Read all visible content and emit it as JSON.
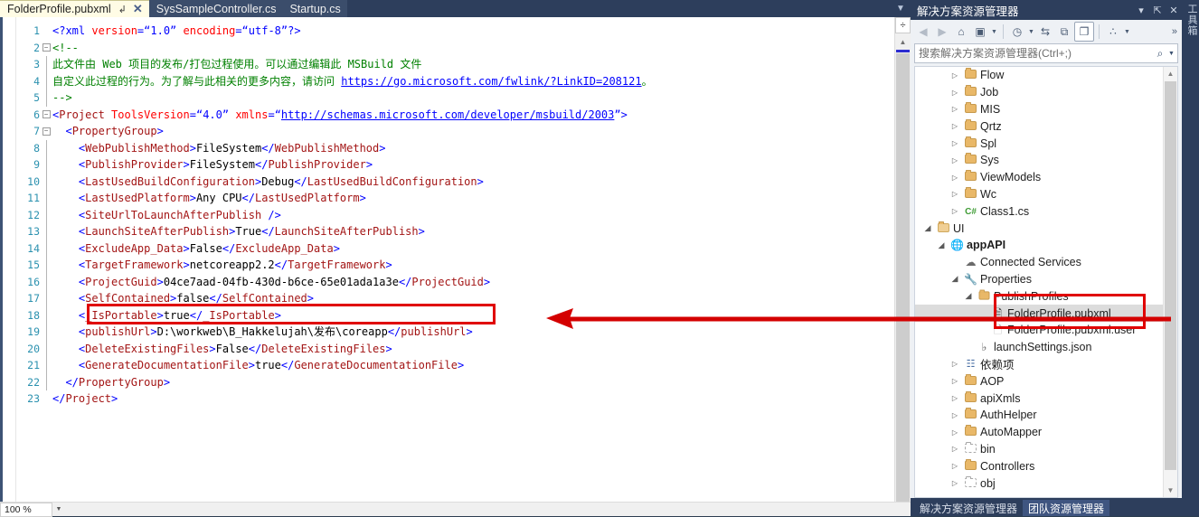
{
  "window": {
    "editor_tabs": [
      {
        "label": "FolderProfile.pubxml",
        "active": true,
        "pin": "↲",
        "close": "✕"
      },
      {
        "label": "SysSampleController.cs",
        "active": false
      },
      {
        "label": "Startup.cs",
        "active": false
      }
    ],
    "tab_overflow_icon": "chevron-down"
  },
  "editor": {
    "zoom_level": "100 %",
    "line_numbers": [
      1,
      2,
      3,
      4,
      5,
      6,
      7,
      8,
      9,
      10,
      11,
      12,
      13,
      14,
      15,
      16,
      17,
      18,
      19,
      20,
      21,
      22,
      23
    ],
    "lines": [
      {
        "n": 1,
        "segs": [
          {
            "t": "<?xml",
            "c": "tk-br"
          },
          {
            "t": " version",
            "c": "tk-at"
          },
          {
            "t": "=",
            "c": "tk-br"
          },
          {
            "t": "“1.0”",
            "c": "tk-vl"
          },
          {
            "t": " encoding",
            "c": "tk-at"
          },
          {
            "t": "=",
            "c": "tk-br"
          },
          {
            "t": "“utf-8”",
            "c": "tk-vl"
          },
          {
            "t": "?>",
            "c": "tk-br"
          }
        ]
      },
      {
        "n": 2,
        "segs": [
          {
            "t": "<!--",
            "c": "tk-cm"
          }
        ]
      },
      {
        "n": 3,
        "segs": [
          {
            "t": "此文件由 Web 项目的发布/打包过程使用。可以通过编辑此 MSBuild 文件",
            "c": "tk-cm"
          }
        ]
      },
      {
        "n": 4,
        "segs": [
          {
            "t": "自定义此过程的行为。为了解与此相关的更多内容，请访问 ",
            "c": "tk-cm"
          },
          {
            "t": "https://go.microsoft.com/fwlink/?LinkID=208121",
            "c": "tk-lk"
          },
          {
            "t": "。",
            "c": "tk-cm"
          }
        ]
      },
      {
        "n": 5,
        "segs": [
          {
            "t": "-->",
            "c": "tk-cm"
          }
        ]
      },
      {
        "n": 6,
        "segs": [
          {
            "t": "<",
            "c": "tk-br"
          },
          {
            "t": "Project",
            "c": "tk-el"
          },
          {
            "t": " ToolsVersion",
            "c": "tk-at"
          },
          {
            "t": "=",
            "c": "tk-br"
          },
          {
            "t": "“4.0”",
            "c": "tk-vl"
          },
          {
            "t": " xmlns",
            "c": "tk-at"
          },
          {
            "t": "=",
            "c": "tk-br"
          },
          {
            "t": "“",
            "c": "tk-vl"
          },
          {
            "t": "http://schemas.microsoft.com/developer/msbuild/2003",
            "c": "tk-lk"
          },
          {
            "t": "”",
            "c": "tk-vl"
          },
          {
            "t": ">",
            "c": "tk-br"
          }
        ]
      },
      {
        "n": 7,
        "segs": [
          {
            "t": "  <",
            "c": "tk-br"
          },
          {
            "t": "PropertyGroup",
            "c": "tk-el"
          },
          {
            "t": ">",
            "c": "tk-br"
          }
        ]
      },
      {
        "n": 8,
        "segs": [
          {
            "t": "    <",
            "c": "tk-br"
          },
          {
            "t": "WebPublishMethod",
            "c": "tk-el"
          },
          {
            "t": ">",
            "c": "tk-br"
          },
          {
            "t": "FileSystem",
            "c": "tk-tx"
          },
          {
            "t": "</",
            "c": "tk-br"
          },
          {
            "t": "WebPublishMethod",
            "c": "tk-el"
          },
          {
            "t": ">",
            "c": "tk-br"
          }
        ]
      },
      {
        "n": 9,
        "segs": [
          {
            "t": "    <",
            "c": "tk-br"
          },
          {
            "t": "PublishProvider",
            "c": "tk-el"
          },
          {
            "t": ">",
            "c": "tk-br"
          },
          {
            "t": "FileSystem",
            "c": "tk-tx"
          },
          {
            "t": "</",
            "c": "tk-br"
          },
          {
            "t": "PublishProvider",
            "c": "tk-el"
          },
          {
            "t": ">",
            "c": "tk-br"
          }
        ]
      },
      {
        "n": 10,
        "segs": [
          {
            "t": "    <",
            "c": "tk-br"
          },
          {
            "t": "LastUsedBuildConfiguration",
            "c": "tk-el"
          },
          {
            "t": ">",
            "c": "tk-br"
          },
          {
            "t": "Debug",
            "c": "tk-tx"
          },
          {
            "t": "</",
            "c": "tk-br"
          },
          {
            "t": "LastUsedBuildConfiguration",
            "c": "tk-el"
          },
          {
            "t": ">",
            "c": "tk-br"
          }
        ]
      },
      {
        "n": 11,
        "segs": [
          {
            "t": "    <",
            "c": "tk-br"
          },
          {
            "t": "LastUsedPlatform",
            "c": "tk-el"
          },
          {
            "t": ">",
            "c": "tk-br"
          },
          {
            "t": "Any CPU",
            "c": "tk-tx"
          },
          {
            "t": "</",
            "c": "tk-br"
          },
          {
            "t": "LastUsedPlatform",
            "c": "tk-el"
          },
          {
            "t": ">",
            "c": "tk-br"
          }
        ]
      },
      {
        "n": 12,
        "segs": [
          {
            "t": "    <",
            "c": "tk-br"
          },
          {
            "t": "SiteUrlToLaunchAfterPublish",
            "c": "tk-el"
          },
          {
            "t": " />",
            "c": "tk-br"
          }
        ]
      },
      {
        "n": 13,
        "segs": [
          {
            "t": "    <",
            "c": "tk-br"
          },
          {
            "t": "LaunchSiteAfterPublish",
            "c": "tk-el"
          },
          {
            "t": ">",
            "c": "tk-br"
          },
          {
            "t": "True",
            "c": "tk-tx"
          },
          {
            "t": "</",
            "c": "tk-br"
          },
          {
            "t": "LaunchSiteAfterPublish",
            "c": "tk-el"
          },
          {
            "t": ">",
            "c": "tk-br"
          }
        ]
      },
      {
        "n": 14,
        "segs": [
          {
            "t": "    <",
            "c": "tk-br"
          },
          {
            "t": "ExcludeApp_Data",
            "c": "tk-el"
          },
          {
            "t": ">",
            "c": "tk-br"
          },
          {
            "t": "False",
            "c": "tk-tx"
          },
          {
            "t": "</",
            "c": "tk-br"
          },
          {
            "t": "ExcludeApp_Data",
            "c": "tk-el"
          },
          {
            "t": ">",
            "c": "tk-br"
          }
        ]
      },
      {
        "n": 15,
        "segs": [
          {
            "t": "    <",
            "c": "tk-br"
          },
          {
            "t": "TargetFramework",
            "c": "tk-el"
          },
          {
            "t": ">",
            "c": "tk-br"
          },
          {
            "t": "netcoreapp2.2",
            "c": "tk-tx"
          },
          {
            "t": "</",
            "c": "tk-br"
          },
          {
            "t": "TargetFramework",
            "c": "tk-el"
          },
          {
            "t": ">",
            "c": "tk-br"
          }
        ]
      },
      {
        "n": 16,
        "segs": [
          {
            "t": "    <",
            "c": "tk-br"
          },
          {
            "t": "ProjectGuid",
            "c": "tk-el"
          },
          {
            "t": ">",
            "c": "tk-br"
          },
          {
            "t": "04ce7aad-04fb-430d-b6ce-65e01ada1a3e",
            "c": "tk-tx"
          },
          {
            "t": "</",
            "c": "tk-br"
          },
          {
            "t": "ProjectGuid",
            "c": "tk-el"
          },
          {
            "t": ">",
            "c": "tk-br"
          }
        ]
      },
      {
        "n": 17,
        "segs": [
          {
            "t": "    <",
            "c": "tk-br"
          },
          {
            "t": "SelfContained",
            "c": "tk-el"
          },
          {
            "t": ">",
            "c": "tk-br"
          },
          {
            "t": "false",
            "c": "tk-tx"
          },
          {
            "t": "</",
            "c": "tk-br"
          },
          {
            "t": "SelfContained",
            "c": "tk-el"
          },
          {
            "t": ">",
            "c": "tk-br"
          }
        ]
      },
      {
        "n": 18,
        "segs": [
          {
            "t": "    <",
            "c": "tk-br"
          },
          {
            "t": "_IsPortable",
            "c": "tk-el"
          },
          {
            "t": ">",
            "c": "tk-br"
          },
          {
            "t": "true",
            "c": "tk-tx"
          },
          {
            "t": "</",
            "c": "tk-br"
          },
          {
            "t": "_IsPortable",
            "c": "tk-el"
          },
          {
            "t": ">",
            "c": "tk-br"
          }
        ]
      },
      {
        "n": 19,
        "segs": [
          {
            "t": "    <",
            "c": "tk-br"
          },
          {
            "t": "publishUrl",
            "c": "tk-el"
          },
          {
            "t": ">",
            "c": "tk-br"
          },
          {
            "t": "D:\\workweb\\B_Hakkelujah\\发布\\coreapp",
            "c": "tk-tx"
          },
          {
            "t": "</",
            "c": "tk-br"
          },
          {
            "t": "publishUrl",
            "c": "tk-el"
          },
          {
            "t": ">",
            "c": "tk-br"
          }
        ]
      },
      {
        "n": 20,
        "segs": [
          {
            "t": "    <",
            "c": "tk-br"
          },
          {
            "t": "DeleteExistingFiles",
            "c": "tk-el"
          },
          {
            "t": ">",
            "c": "tk-br"
          },
          {
            "t": "False",
            "c": "tk-tx"
          },
          {
            "t": "</",
            "c": "tk-br"
          },
          {
            "t": "DeleteExistingFiles",
            "c": "tk-el"
          },
          {
            "t": ">",
            "c": "tk-br"
          }
        ]
      },
      {
        "n": 21,
        "segs": [
          {
            "t": "    <",
            "c": "tk-br"
          },
          {
            "t": "GenerateDocumentationFile",
            "c": "tk-el"
          },
          {
            "t": ">",
            "c": "tk-br"
          },
          {
            "t": "true",
            "c": "tk-tx"
          },
          {
            "t": "</",
            "c": "tk-br"
          },
          {
            "t": "GenerateDocumentationFile",
            "c": "tk-el"
          },
          {
            "t": ">",
            "c": "tk-br"
          }
        ]
      },
      {
        "n": 22,
        "segs": [
          {
            "t": "  </",
            "c": "tk-br"
          },
          {
            "t": "PropertyGroup",
            "c": "tk-el"
          },
          {
            "t": ">",
            "c": "tk-br"
          }
        ]
      },
      {
        "n": 23,
        "segs": [
          {
            "t": "</",
            "c": "tk-br"
          },
          {
            "t": "Project",
            "c": "tk-el"
          },
          {
            "t": ">",
            "c": "tk-br"
          }
        ]
      }
    ],
    "fold_markers": [
      {
        "line": 2,
        "state": "minus"
      },
      {
        "line": 6,
        "state": "minus"
      },
      {
        "line": 7,
        "state": "minus"
      }
    ],
    "split_icon": "÷",
    "scroll_up_icon": "▲"
  },
  "solution_explorer": {
    "title": "解决方案资源管理器",
    "title_buttons": [
      {
        "name": "dropdown",
        "glyph": "▾"
      },
      {
        "name": "pin",
        "glyph": "⇱"
      },
      {
        "name": "close",
        "glyph": "✕"
      }
    ],
    "toolbar": [
      {
        "name": "back",
        "glyph": "◀",
        "disabled": true
      },
      {
        "name": "forward",
        "glyph": "▶",
        "disabled": true
      },
      {
        "name": "home",
        "glyph": "⌂"
      },
      {
        "name": "solution-folder",
        "glyph": "▤",
        "caret": true
      },
      {
        "name": "pending-changes",
        "glyph": "◷",
        "caret": true
      },
      {
        "name": "sync-with-active-document",
        "glyph": "⇆"
      },
      {
        "name": "refresh",
        "glyph": "⧉"
      },
      {
        "name": "show-all-files",
        "glyph": "❐",
        "boxed": true
      },
      {
        "name": "view-class-diagram",
        "glyph": "∴",
        "caret": true
      }
    ],
    "search": {
      "placeholder": "搜索解决方案资源管理器(Ctrl+;)",
      "value": "",
      "icon": "⌕",
      "caret": "▾"
    },
    "tree": [
      {
        "label": "Flow",
        "indent": 2,
        "arrow": "closed",
        "icon": "folder"
      },
      {
        "label": "Job",
        "indent": 2,
        "arrow": "closed",
        "icon": "folder"
      },
      {
        "label": "MIS",
        "indent": 2,
        "arrow": "closed",
        "icon": "folder"
      },
      {
        "label": "Qrtz",
        "indent": 2,
        "arrow": "closed",
        "icon": "folder"
      },
      {
        "label": "Spl",
        "indent": 2,
        "arrow": "closed",
        "icon": "folder"
      },
      {
        "label": "Sys",
        "indent": 2,
        "arrow": "closed",
        "icon": "folder"
      },
      {
        "label": "ViewModels",
        "indent": 2,
        "arrow": "closed",
        "icon": "folder"
      },
      {
        "label": "Wc",
        "indent": 2,
        "arrow": "closed",
        "icon": "folder"
      },
      {
        "label": "Class1.cs",
        "indent": 2,
        "arrow": "closed",
        "icon": "csharp"
      },
      {
        "label": "UI",
        "indent": 0,
        "arrow": "open",
        "icon": "folder-open"
      },
      {
        "label": "appAPI",
        "indent": 1,
        "arrow": "open",
        "icon": "web-project",
        "bold": true
      },
      {
        "label": "Connected Services",
        "indent": 2,
        "arrow": "none",
        "icon": "connected-services"
      },
      {
        "label": "Properties",
        "indent": 2,
        "arrow": "open",
        "icon": "wrench"
      },
      {
        "label": "PublishProfiles",
        "indent": 3,
        "arrow": "open",
        "icon": "folder-publish"
      },
      {
        "label": "FolderProfile.pubxml",
        "indent": 4,
        "arrow": "none",
        "icon": "pubxml-file",
        "selected": true
      },
      {
        "label": "FolderProfile.pubxml.user",
        "indent": 4,
        "arrow": "none",
        "icon": "file-faint"
      },
      {
        "label": "launchSettings.json",
        "indent": 3,
        "arrow": "none",
        "icon": "json-file"
      },
      {
        "label": "依赖项",
        "indent": 2,
        "arrow": "closed",
        "icon": "dependencies"
      },
      {
        "label": "AOP",
        "indent": 2,
        "arrow": "closed",
        "icon": "folder"
      },
      {
        "label": "apiXmls",
        "indent": 2,
        "arrow": "closed",
        "icon": "folder"
      },
      {
        "label": "AuthHelper",
        "indent": 2,
        "arrow": "closed",
        "icon": "folder"
      },
      {
        "label": "AutoMapper",
        "indent": 2,
        "arrow": "closed",
        "icon": "folder"
      },
      {
        "label": "bin",
        "indent": 2,
        "arrow": "closed",
        "icon": "folder-dotted"
      },
      {
        "label": "Controllers",
        "indent": 2,
        "arrow": "closed",
        "icon": "folder"
      },
      {
        "label": "obj",
        "indent": 2,
        "arrow": "closed",
        "icon": "folder-dotted"
      }
    ],
    "bottom_tabs": [
      {
        "label": "解决方案资源管理器",
        "active": false
      },
      {
        "label": "团队资源管理器",
        "active": true
      }
    ],
    "scroll_up_icon": "▲",
    "scroll_down_icon": "▼"
  },
  "right_rail": {
    "label": "工具箱"
  },
  "annotations": {
    "color": "#e00000",
    "code_highlight_line": 21,
    "tree_highlight_labels": [
      "PublishProfiles",
      "FolderProfile.pubxml"
    ],
    "arrow_direction": "left"
  }
}
